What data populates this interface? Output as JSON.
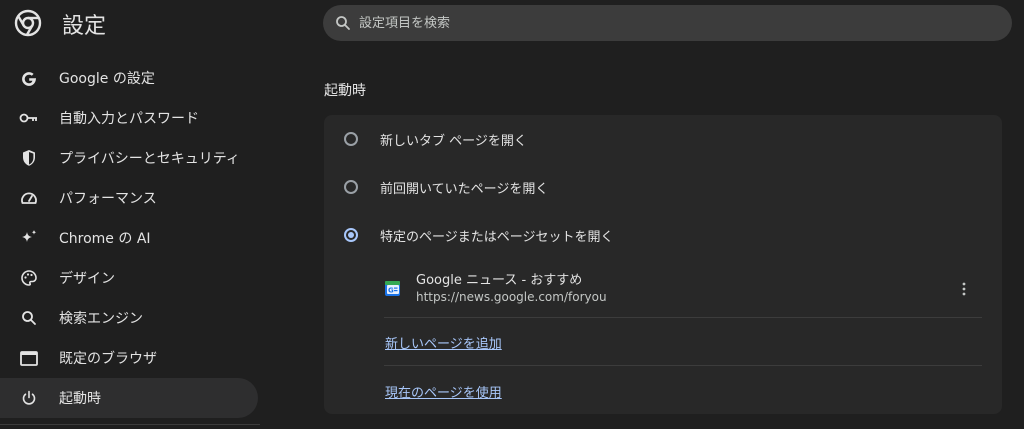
{
  "app": {
    "title": "設定"
  },
  "search": {
    "placeholder": "設定項目を検索"
  },
  "sidebar": {
    "items": [
      {
        "label": "Google の設定",
        "icon": "google-g-icon"
      },
      {
        "label": "自動入力とパスワード",
        "icon": "key-icon"
      },
      {
        "label": "プライバシーとセキュリティ",
        "icon": "shield-icon"
      },
      {
        "label": "パフォーマンス",
        "icon": "speedometer-icon"
      },
      {
        "label": "Chrome の AI",
        "icon": "sparkle-icon"
      },
      {
        "label": "デザイン",
        "icon": "palette-icon"
      },
      {
        "label": "検索エンジン",
        "icon": "search-icon"
      },
      {
        "label": "既定のブラウザ",
        "icon": "browser-window-icon"
      },
      {
        "label": "起動時",
        "icon": "power-icon",
        "active": true
      }
    ]
  },
  "startup": {
    "section_title": "起動時",
    "options": [
      {
        "label": "新しいタブ ページを開く",
        "checked": false
      },
      {
        "label": "前回開いていたページを開く",
        "checked": false
      },
      {
        "label": "特定のページまたはページセットを開く",
        "checked": true
      }
    ],
    "pages": [
      {
        "name": "Google ニュース - おすすめ",
        "url": "https://news.google.com/foryou",
        "icon": "google-news-icon"
      }
    ],
    "add_page_label": "新しいページを追加",
    "use_current_label": "現在のページを使用"
  },
  "colors": {
    "background": "#1f1f1f",
    "card": "#282828",
    "accent": "#a8c7fa",
    "active_nav": "#2e2e2f"
  }
}
